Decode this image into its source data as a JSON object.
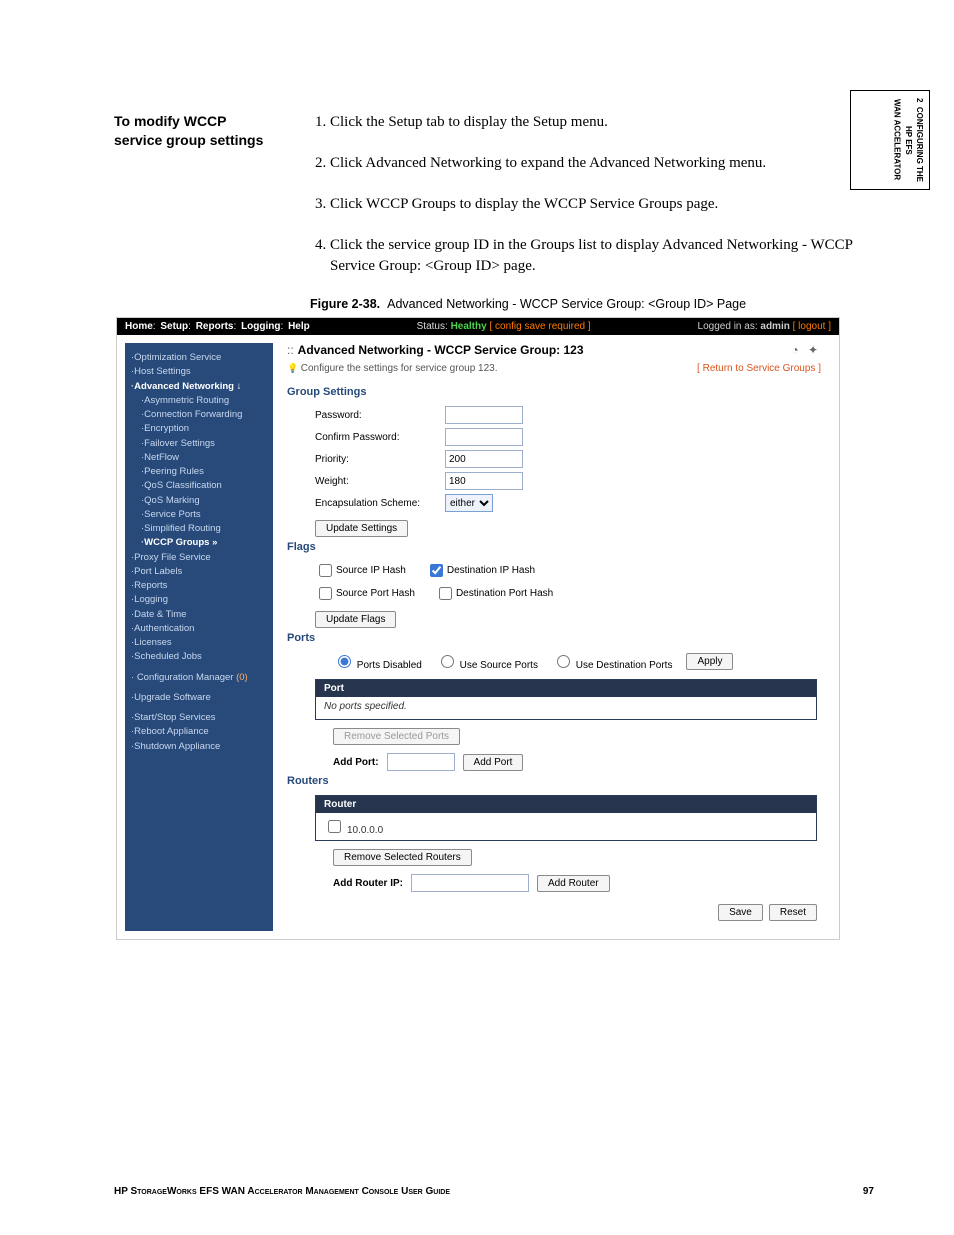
{
  "side_tab": {
    "line1": "2",
    "line2": "CONFIGURING THE HP EFS",
    "line3": "WAN ACCELERATOR"
  },
  "left_head": {
    "l1": "To modify WCCP",
    "l2": "service group settings"
  },
  "steps": [
    "Click the Setup tab to display the Setup menu.",
    "Click Advanced Networking to expand the Advanced Networking menu.",
    "Click WCCP Groups to display the WCCP Service Groups page.",
    "Click the service group ID in the Groups list to display Advanced Networking - WCCP Service Group: <Group ID> page."
  ],
  "figure": {
    "num": "Figure 2-38.",
    "caption": "Advanced Networking - WCCP Service Group: <Group ID> Page"
  },
  "ss": {
    "topnav": {
      "items": [
        "Home",
        "Setup",
        "Reports",
        "Logging",
        "Help"
      ]
    },
    "status": {
      "label": "Status:",
      "value": "Healthy",
      "note": "[ config save required ]"
    },
    "login": {
      "prefix": "Logged in as:",
      "user": "admin",
      "logout": "[ logout ]"
    },
    "sidebar": {
      "items": [
        {
          "t": "Optimization Service",
          "cls": ""
        },
        {
          "t": "Host Settings",
          "cls": ""
        },
        {
          "t": "Advanced Networking ↓",
          "cls": "bold"
        },
        {
          "t": "Asymmetric Routing",
          "cls": "sub"
        },
        {
          "t": "Connection Forwarding",
          "cls": "sub"
        },
        {
          "t": "Encryption",
          "cls": "sub"
        },
        {
          "t": "Failover Settings",
          "cls": "sub"
        },
        {
          "t": "NetFlow",
          "cls": "sub"
        },
        {
          "t": "Peering Rules",
          "cls": "sub"
        },
        {
          "t": "QoS Classification",
          "cls": "sub"
        },
        {
          "t": "QoS Marking",
          "cls": "sub"
        },
        {
          "t": "Service Ports",
          "cls": "sub"
        },
        {
          "t": "Simplified Routing",
          "cls": "sub"
        },
        {
          "t": "WCCP Groups »",
          "cls": "sub bold"
        },
        {
          "t": "Proxy File Service",
          "cls": ""
        },
        {
          "t": "Port Labels",
          "cls": ""
        },
        {
          "t": "Reports",
          "cls": ""
        },
        {
          "t": "Logging",
          "cls": ""
        },
        {
          "t": "Date & Time",
          "cls": ""
        },
        {
          "t": "Authentication",
          "cls": ""
        },
        {
          "t": "Licenses",
          "cls": ""
        },
        {
          "t": "Scheduled Jobs",
          "cls": ""
        }
      ],
      "cfg_mgr": "Configuration Manager",
      "cfg_badge": "(0)",
      "items2": [
        {
          "t": "Upgrade Software"
        },
        {
          "t": "Start/Stop Services"
        },
        {
          "t": "Reboot Appliance"
        },
        {
          "t": "Shutdown Appliance"
        }
      ]
    },
    "main": {
      "title_prefix": "::",
      "title": "Advanced Networking - WCCP Service Group: 123",
      "hint": "Configure the settings for service group 123.",
      "return_link": "[ Return to Service Groups ]",
      "group_settings": {
        "heading": "Group Settings",
        "password": "Password:",
        "confirm": "Confirm Password:",
        "priority": "Priority:",
        "priority_val": "200",
        "weight": "Weight:",
        "weight_val": "180",
        "encap": "Encapsulation Scheme:",
        "encap_val": "either",
        "update_btn": "Update Settings"
      },
      "flags": {
        "heading": "Flags",
        "src_ip": "Source IP Hash",
        "dst_ip": "Destination IP Hash",
        "src_port": "Source Port Hash",
        "dst_port": "Destination Port Hash",
        "update_btn": "Update Flags"
      },
      "ports": {
        "heading": "Ports",
        "opt_disabled": "Ports Disabled",
        "opt_src": "Use Source Ports",
        "opt_dst": "Use Destination Ports",
        "apply": "Apply",
        "th": "Port",
        "empty": "No ports specified.",
        "remove": "Remove Selected Ports",
        "add_label": "Add Port:",
        "add_btn": "Add Port"
      },
      "routers": {
        "heading": "Routers",
        "th": "Router",
        "row": "10.0.0.0",
        "remove": "Remove Selected Routers",
        "add_label": "Add Router IP:",
        "add_btn": "Add Router"
      },
      "save": "Save",
      "reset": "Reset"
    }
  },
  "footer": {
    "left": "HP StorageWorks EFS WAN Accelerator Management Console User Guide",
    "right": "97"
  }
}
